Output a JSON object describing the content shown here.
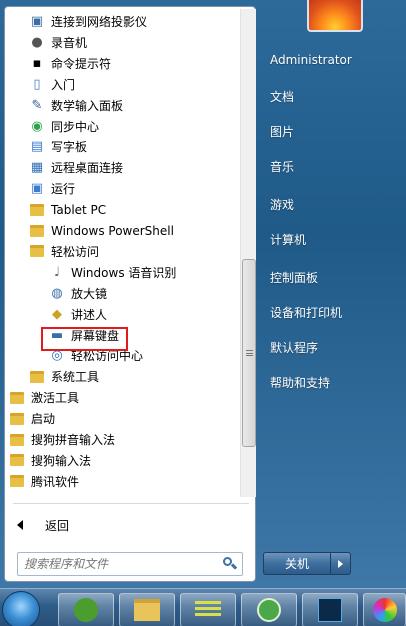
{
  "programs": [
    {
      "label": "连接到网络投影仪",
      "icon": "projector-icon",
      "indent": 1
    },
    {
      "label": "录音机",
      "icon": "microphone-icon",
      "indent": 1
    },
    {
      "label": "命令提示符",
      "icon": "command-prompt-icon",
      "indent": 1
    },
    {
      "label": "入门",
      "icon": "getting-started-icon",
      "indent": 1
    },
    {
      "label": "数学输入面板",
      "icon": "math-input-icon",
      "indent": 1
    },
    {
      "label": "同步中心",
      "icon": "sync-center-icon",
      "indent": 1
    },
    {
      "label": "写字板",
      "icon": "wordpad-icon",
      "indent": 1
    },
    {
      "label": "远程桌面连接",
      "icon": "remote-desktop-icon",
      "indent": 1
    },
    {
      "label": "运行",
      "icon": "run-icon",
      "indent": 1
    },
    {
      "label": "Tablet PC",
      "icon": "folder-icon",
      "indent": 1
    },
    {
      "label": "Windows PowerShell",
      "icon": "folder-icon",
      "indent": 1
    },
    {
      "label": "轻松访问",
      "icon": "folder-icon",
      "indent": 1
    },
    {
      "label": "Windows 语音识别",
      "icon": "speech-recognition-icon",
      "indent": 2
    },
    {
      "label": "放大镜",
      "icon": "magnifier-icon",
      "indent": 2
    },
    {
      "label": "讲述人",
      "icon": "narrator-icon",
      "indent": 2
    },
    {
      "label": "屏幕键盘",
      "icon": "keyboard-icon",
      "indent": 2
    },
    {
      "label": "轻松访问中心",
      "icon": "ease-of-access-icon",
      "indent": 2
    },
    {
      "label": "系统工具",
      "icon": "folder-icon",
      "indent": 1
    },
    {
      "label": "激活工具",
      "icon": "folder-icon",
      "indent": 0
    },
    {
      "label": "启动",
      "icon": "folder-icon",
      "indent": 0
    },
    {
      "label": "搜狗拼音输入法",
      "icon": "folder-icon",
      "indent": 0
    },
    {
      "label": "搜狗输入法",
      "icon": "folder-icon",
      "indent": 0
    },
    {
      "label": "腾讯软件",
      "icon": "folder-icon",
      "indent": 0
    }
  ],
  "back_label": "返回",
  "search": {
    "placeholder": "搜索程序和文件"
  },
  "right_panel": {
    "items": [
      "Administrator",
      "文档",
      "图片",
      "音乐",
      "游戏",
      "计算机",
      "控制面板",
      "设备和打印机",
      "默认程序",
      "帮助和支持"
    ]
  },
  "shutdown": {
    "label": "关机"
  },
  "colors": {
    "highlight": "#e01b1b",
    "folder": "#e8bf45"
  }
}
